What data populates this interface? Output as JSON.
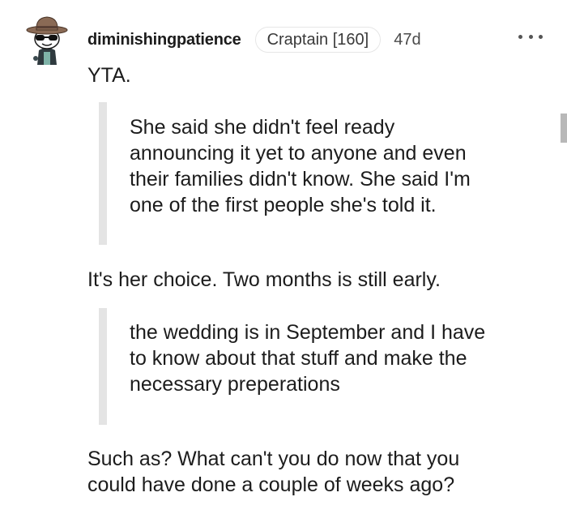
{
  "comment": {
    "username": "diminishingpatience",
    "flair": "Craptain [160]",
    "age": "47d",
    "more_icon": "more-horizontal-icon",
    "avatar_icon": "snoo-cowboy-avatar-icon",
    "blocks": [
      {
        "type": "text",
        "content": "YTA."
      },
      {
        "type": "quote",
        "lines": [
          "She said she didn't feel ready",
          "announcing it yet to anyone and even",
          "their families didn't know. She said I'm",
          "one of the first people she's told it."
        ]
      },
      {
        "type": "text",
        "content": "It's her choice. Two months is still early."
      },
      {
        "type": "quote",
        "lines": [
          "the wedding is in September and I have",
          "to know about that stuff and make the",
          "necessary preperations"
        ]
      },
      {
        "type": "text",
        "lines": [
          "Such as? What can't you do now that you",
          "could have done a couple of weeks ago?"
        ]
      }
    ]
  }
}
